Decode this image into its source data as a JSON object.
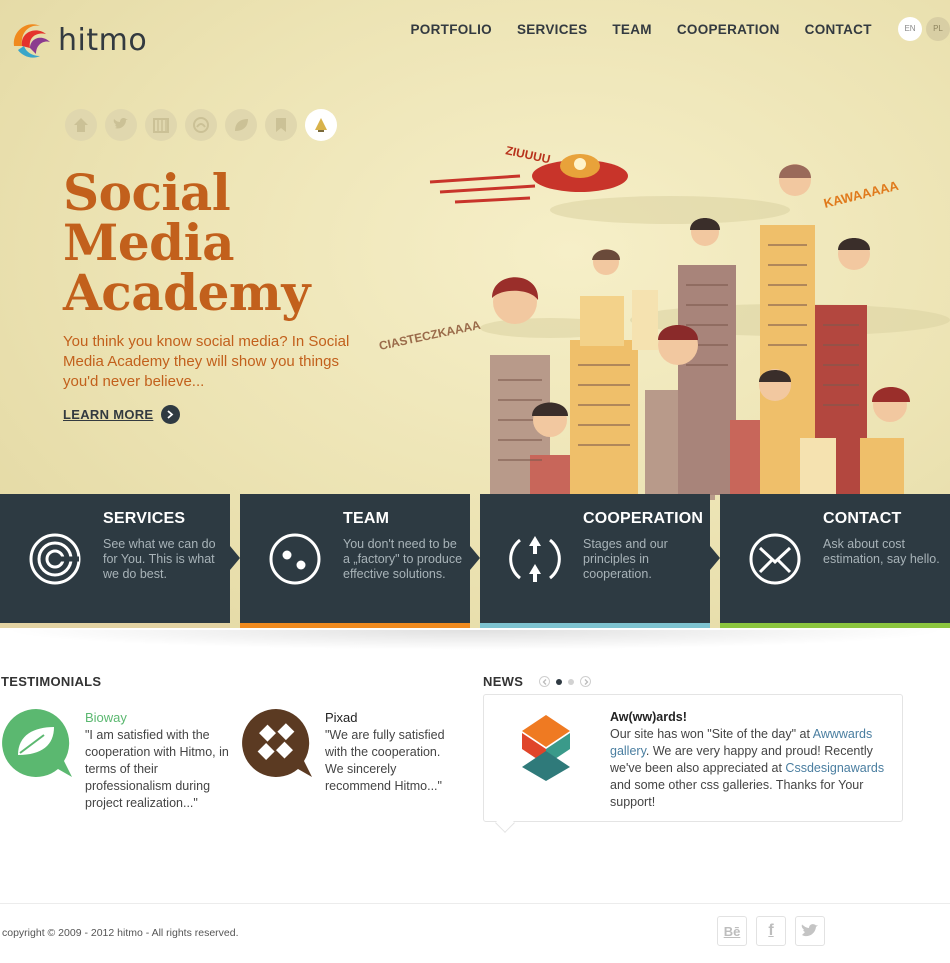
{
  "brand": {
    "name": "hitmo"
  },
  "nav": [
    {
      "label": "PORTFOLIO"
    },
    {
      "label": "SERVICES"
    },
    {
      "label": "TEAM"
    },
    {
      "label": "COOPERATION"
    },
    {
      "label": "CONTACT"
    }
  ],
  "languages": [
    {
      "label": "EN",
      "active": true
    },
    {
      "label": "PL",
      "active": false
    }
  ],
  "social_icons": [
    {
      "icon": "home-icon"
    },
    {
      "icon": "twitter-icon"
    },
    {
      "icon": "calendar-icon"
    },
    {
      "icon": "blogger-icon"
    },
    {
      "icon": "leaf-icon"
    },
    {
      "icon": "bookmark-icon"
    },
    {
      "icon": "academy-icon",
      "active": true
    }
  ],
  "hero": {
    "title_line1": "Social",
    "title_line2": "Media",
    "title_line3": "Academy",
    "lead": "You think you know social media? In Social Media Academy they will show you things you'd never believe...",
    "cta": "LEARN MORE",
    "illustration_words": {
      "ufo": "ZIUUUU",
      "right": "KAWAAAAA",
      "left": "CIASTECZKAAAA"
    }
  },
  "boxes": [
    {
      "title": "SERVICES",
      "desc": "See what we can do for You. This is what we do best.",
      "icon": "spiral-icon",
      "accent": "#e3d3a3"
    },
    {
      "title": "TEAM",
      "desc": "You don't need to be a „factory\" to produce effective solutions.",
      "icon": "dots-circle-icon",
      "accent": "#ef8a1f"
    },
    {
      "title": "COOPERATION",
      "desc": "Stages and our principles in cooperation.",
      "icon": "arrows-icon",
      "accent": "#7ec3d0"
    },
    {
      "title": "CONTACT",
      "desc": "Ask about cost estimation, say hello.",
      "icon": "envelope-icon",
      "accent": "#8cc63f"
    }
  ],
  "testimonials": {
    "title": "TESTIMONIALS",
    "items": [
      {
        "name": "Bioway",
        "quote": "\"I am satisfied with the cooperation with Hitmo, in terms of their professionalism during project realization...\"",
        "color": "#5bb870"
      },
      {
        "name": "Pixad",
        "quote": "\"We are fully satisfied with the cooperation. We sincerely recommend Hitmo...\"",
        "color": "#5b3a22"
      }
    ]
  },
  "news": {
    "title": "NEWS",
    "item_title": "Aw(ww)ards!",
    "text_1": "Our site has won \"Site of the day\" at ",
    "link_1": "Awwwards gallery",
    "text_2": ". We are very happy and proud! Recently we've been also appreciated at ",
    "link_2": "Cssdesignawards",
    "text_3": " and some other css galleries. Thanks for Your support!"
  },
  "footer": {
    "copyright": "copyright © 2009 - 2012 hitmo - All rights reserved.",
    "social": [
      {
        "label": "Bē"
      },
      {
        "label": "f"
      },
      {
        "label": "t"
      }
    ]
  }
}
